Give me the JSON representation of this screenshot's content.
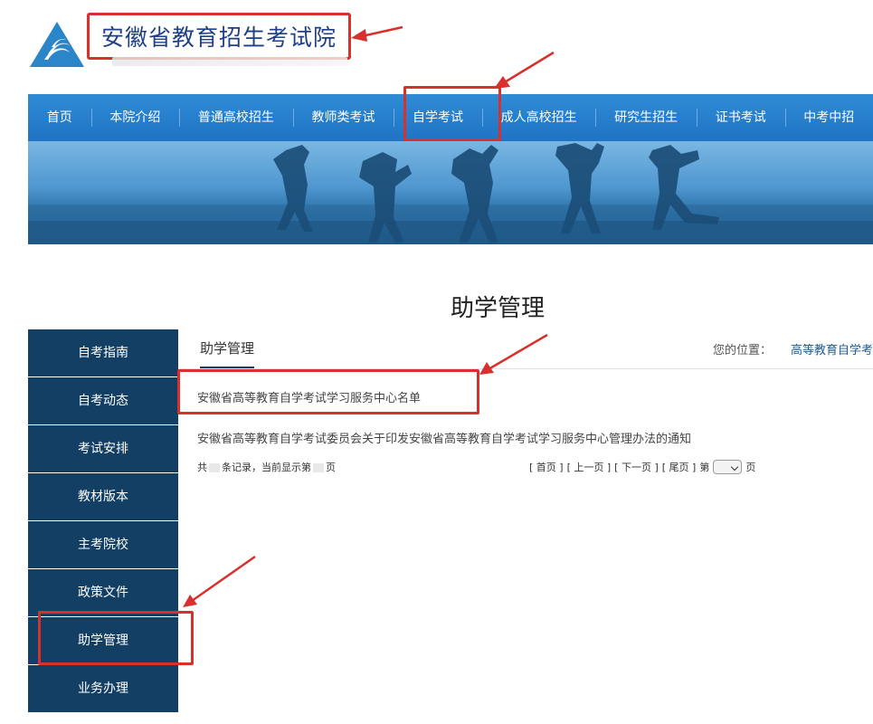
{
  "site": {
    "title": "安徽省教育招生考试院"
  },
  "nav": {
    "items": [
      "首页",
      "本院介绍",
      "普通高校招生",
      "教师类考试",
      "自学考试",
      "成人高校招生",
      "研究生招生",
      "证书考试",
      "中考中招"
    ],
    "active": "自学考试"
  },
  "page": {
    "title": "助学管理"
  },
  "sidebar": {
    "items": [
      "自考指南",
      "自考动态",
      "考试安排",
      "教材版本",
      "主考院校",
      "政策文件",
      "助学管理",
      "业务办理"
    ],
    "active": "助学管理"
  },
  "content": {
    "tab": "助学管理",
    "breadcrumb_label": "您的位置：",
    "breadcrumb_path": "高等教育自学考",
    "articles": [
      "安徽省高等教育自学考试学习服务中心名单",
      "安徽省高等教育自学考试委员会关于印发安徽省高等教育自学考试学习服务中心管理办法的通知"
    ]
  },
  "pager": {
    "info_prefix": "共",
    "info_mid": "条记录，当前显示第",
    "info_suffix": "页",
    "first": "[ 首页 ]",
    "prev": "[ 上一页 ]",
    "next": "[ 下一页 ]",
    "last": "[ 尾页 ]",
    "goto_prefix": "第",
    "goto_suffix": "页"
  },
  "colors": {
    "nav_blue": "#2f8bd6",
    "sidebar_navy": "#123f63",
    "highlight_red": "#d8302d"
  }
}
